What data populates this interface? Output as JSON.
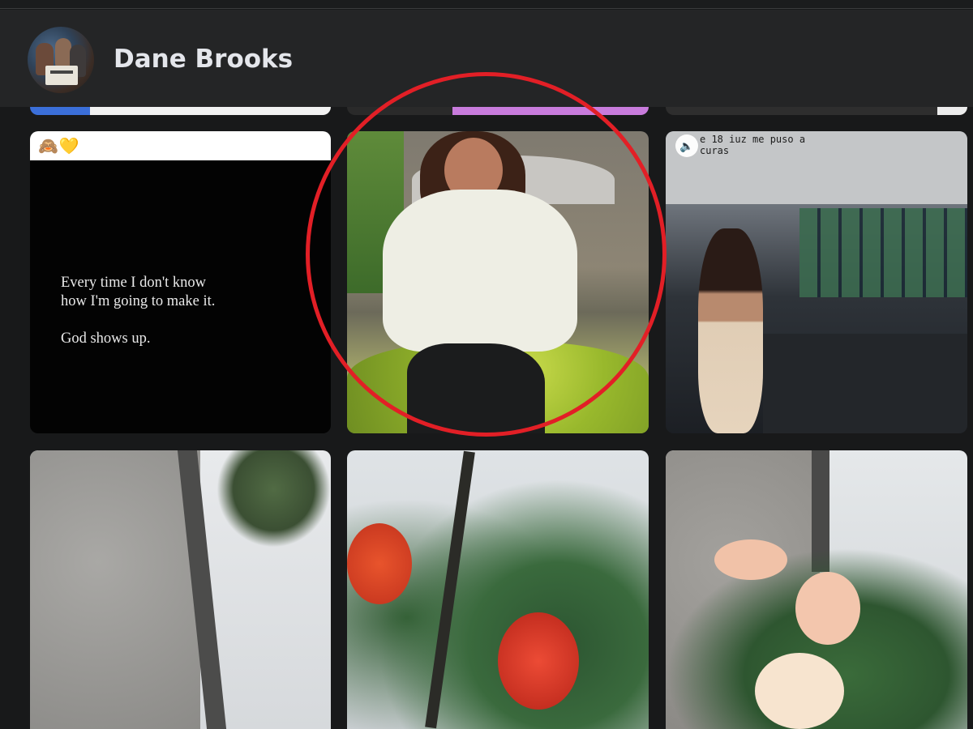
{
  "profile": {
    "name": "Dane Brooks",
    "avatar_icon": "profile-photo"
  },
  "grid": {
    "tiles": [
      {
        "kind": "text-post",
        "header_emoji": "🙈💛",
        "lines": [
          "Every time I don't know",
          "how I'm going to make it."
        ],
        "closing": "God shows up."
      },
      {
        "kind": "photo",
        "subject": "woman-in-white-shirt"
      },
      {
        "kind": "video",
        "caption_lines": [
          "e 18 iuz me puso a",
          "curas"
        ],
        "sound_icon": "speaker-icon"
      },
      {
        "kind": "photo",
        "subject": "wall-and-fronds"
      },
      {
        "kind": "photo",
        "subject": "red-flowers"
      },
      {
        "kind": "photo",
        "subject": "pink-flowers"
      }
    ]
  },
  "annotation": {
    "color": "#e21f26",
    "shape": "circle"
  },
  "colors": {
    "header": "#242526",
    "background": "#18191a",
    "name_text": "#e4e6eb"
  }
}
